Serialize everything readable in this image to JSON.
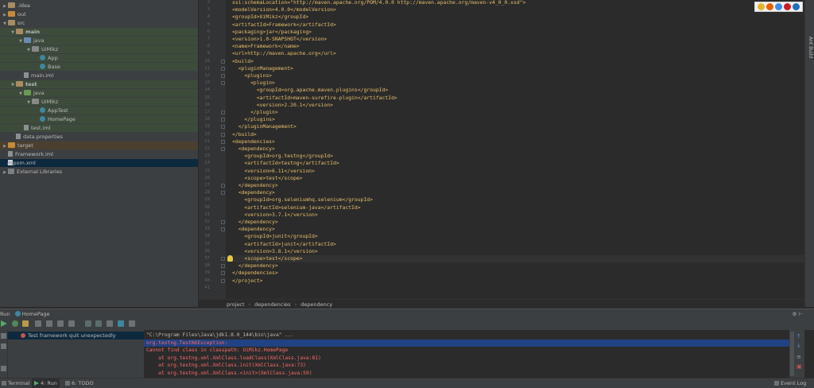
{
  "tree": [
    {
      "label": ".idea",
      "indent": 0,
      "icon": "folder",
      "arrow": "▶"
    },
    {
      "label": "out",
      "indent": 0,
      "icon": "folder-orange",
      "arrow": "▶"
    },
    {
      "label": "src",
      "indent": 0,
      "icon": "folder",
      "arrow": "▼"
    },
    {
      "label": "main",
      "indent": 1,
      "icon": "folder",
      "arrow": "▼",
      "bold": true
    },
    {
      "label": "java",
      "indent": 2,
      "icon": "folder-blue",
      "arrow": "▼"
    },
    {
      "label": "UiMikz",
      "indent": 3,
      "icon": "pkg",
      "arrow": "▼"
    },
    {
      "label": "App",
      "indent": 4,
      "icon": "cls",
      "arrow": ""
    },
    {
      "label": "Base",
      "indent": 4,
      "icon": "cls",
      "arrow": ""
    },
    {
      "label": "main.iml",
      "indent": 2,
      "icon": "file",
      "arrow": ""
    },
    {
      "label": "test",
      "indent": 1,
      "icon": "folder",
      "arrow": "▼",
      "bold": true
    },
    {
      "label": "java",
      "indent": 2,
      "icon": "folder-green",
      "arrow": "▼"
    },
    {
      "label": "UiMikz",
      "indent": 3,
      "icon": "pkg",
      "arrow": "▼"
    },
    {
      "label": "AppTest",
      "indent": 4,
      "icon": "cls",
      "arrow": ""
    },
    {
      "label": "HomePage",
      "indent": 4,
      "icon": "cls",
      "arrow": ""
    },
    {
      "label": "test.iml",
      "indent": 2,
      "icon": "file",
      "arrow": ""
    },
    {
      "label": "data.properties",
      "indent": 1,
      "icon": "file",
      "arrow": ""
    },
    {
      "label": "target",
      "indent": 0,
      "icon": "folder-orange",
      "arrow": "▶"
    },
    {
      "label": "Framework.iml",
      "indent": 0,
      "icon": "file",
      "arrow": ""
    },
    {
      "label": "pom.xml",
      "indent": 0,
      "icon": "xml",
      "arrow": "",
      "prefix": "m"
    },
    {
      "label": "External Libraries",
      "indent": 0,
      "icon": "lib",
      "arrow": "▶"
    }
  ],
  "editor": {
    "first_line": 2,
    "lines": [
      "xsi:schemaLocation=\"http://maven.apache.org/POM/4.0.0 http://maven.apache.org/maven-v4_0_0.xsd\">",
      "<modelVersion>4.0.0</modelVersion>",
      "<groupId>UiMikz</groupId>",
      "<artifactId>Framework</artifactId>",
      "<packaging>jar</packaging>",
      "<version>1.0-SNAPSHOT</version>",
      "<name>Framework</name>",
      "<url>http://maven.apache.org</url>",
      "<build>",
      "  <pluginManagement>",
      "    <plugins>",
      "      <plugin>",
      "        <groupId>org.apache.maven.plugins</groupId>",
      "        <artifactId>maven-surefire-plugin</artifactId>",
      "        <version>2.20.1</version>",
      "      </plugin>",
      "    </plugins>",
      "  </pluginManagement>",
      "</build>",
      "<dependencies>",
      "  <dependency>",
      "    <groupId>org.testng</groupId>",
      "    <artifactId>testng</artifactId>",
      "    <version>6.11</version>",
      "    <scope>test</scope>",
      "  </dependency>",
      "  <dependency>",
      "    <groupId>org.seleniumhq.selenium</groupId>",
      "    <artifactId>selenium-java</artifactId>",
      "    <version>3.7.1</version>",
      "  </dependency>",
      "  <dependency>",
      "    <groupId>junit</groupId>",
      "    <artifactId>junit</artifactId>",
      "    <version>3.8.1</version>",
      "    <scope>test</scope>",
      "  </dependency>",
      "</dependencies>",
      "</project>",
      ""
    ],
    "caret_line": 37
  },
  "breadcrumb": [
    "project",
    "dependencies",
    "dependency"
  ],
  "right_strip_label": "Ant Build",
  "run": {
    "title": "Run",
    "tab_name": "HomePage",
    "left_item": "Test framework quit unexpectedly",
    "console": [
      {
        "text": "\"C:\\Program Files\\Java\\jdk1.8.0_144\\bin\\java\" ...",
        "color": "#bbbbbb"
      },
      {
        "text": "org.testng.TestNGException:",
        "color": "#ff6b68",
        "sel": true
      },
      {
        "text": "Cannot find class in classpath: UiMikz.HomePage",
        "color": "#ff6b68"
      },
      {
        "text": "    at org.testng.xml.XmlClass.loadClass(XmlClass.java:81)",
        "color": "#ff6b68"
      },
      {
        "text": "    at org.testng.xml.XmlClass.init(XmlClass.java:73)",
        "color": "#ff6b68"
      },
      {
        "text": "    at org.testng.xml.XmlClass.<init>(XmlClass.java:59)",
        "color": "#ff6b68"
      }
    ]
  },
  "bottom": {
    "terminal": "Terminal",
    "run": "4: Run",
    "todo": "6: TODO",
    "event_log": "Event Log"
  }
}
